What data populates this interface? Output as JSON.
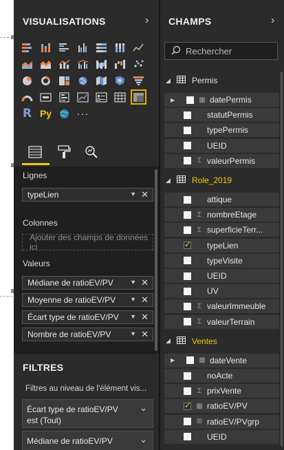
{
  "visualisations": {
    "title": "VISUALISATIONS",
    "collapse_glyph": "›",
    "icons": [
      [
        "stacked-bar-icon",
        "stacked-column-icon",
        "clustered-bar-icon",
        "clustered-column-icon",
        "100-stacked-bar-icon",
        "100-stacked-column-icon",
        "line-chart-icon"
      ],
      [
        "area-chart-icon",
        "stacked-area-icon",
        "line-column-icon",
        "line-clustered-column-icon",
        "ribbon-chart-icon",
        "waterfall-icon",
        "scatter-icon"
      ],
      [
        "pie-chart-icon",
        "donut-chart-icon",
        "treemap-icon",
        "map-icon",
        "filled-map-icon",
        "shape-map-icon",
        "funnel-icon"
      ],
      [
        "gauge-icon",
        "card-icon",
        "multi-row-card-icon",
        "kpi-icon",
        "slicer-icon",
        "table-icon",
        "matrix-icon"
      ],
      [
        "r-visual-icon",
        "python-visual-icon",
        "arcgis-icon",
        "more-visuals-icon"
      ]
    ],
    "r_label": "R",
    "py_label": "Py",
    "more_label": "···",
    "tabs": [
      "fields-tab-icon",
      "format-tab-icon",
      "analytics-tab-icon"
    ]
  },
  "wells": {
    "rows_label": "Lignes",
    "rows_fields": [
      "typeLien"
    ],
    "columns_label": "Colonnes",
    "columns_placeholder": "Ajouter des champs de données ici",
    "values_label": "Valeurs",
    "values_fields": [
      "Médiane de ratioEV/PV",
      "Moyenne de ratioEV/PV",
      "Écart type de ratioEV/PV",
      "Nombre de ratioEV/PV"
    ]
  },
  "filters": {
    "title": "FILTRES",
    "subtitle": "Filtres au niveau de l'élément vis...",
    "cards": [
      {
        "name": "Écart type de ratioEV/PV",
        "state": "est (Tout)"
      },
      {
        "name": "Médiane de ratioEV/PV",
        "state": ""
      }
    ]
  },
  "fields": {
    "title": "CHAMPS",
    "collapse_glyph": "›",
    "search_placeholder": "Rechercher",
    "tables": [
      {
        "name": "Permis",
        "highlight": false,
        "items": [
          {
            "name": "datePermis",
            "type": "date",
            "checked": false,
            "expandable": true
          },
          {
            "name": "statutPermis",
            "type": "",
            "checked": false
          },
          {
            "name": "typePermis",
            "type": "",
            "checked": false
          },
          {
            "name": "UEID",
            "type": "",
            "checked": false
          },
          {
            "name": "valeurPermis",
            "type": "sum",
            "checked": false
          }
        ]
      },
      {
        "name": "Role_2019",
        "highlight": true,
        "items": [
          {
            "name": "attique",
            "type": "",
            "checked": false
          },
          {
            "name": "nombreEtage",
            "type": "sum",
            "checked": false
          },
          {
            "name": "superficieTerr...",
            "type": "sum",
            "checked": false
          },
          {
            "name": "typeLien",
            "type": "",
            "checked": true
          },
          {
            "name": "typeVisite",
            "type": "",
            "checked": false
          },
          {
            "name": "UEID",
            "type": "",
            "checked": false
          },
          {
            "name": "UV",
            "type": "",
            "checked": false
          },
          {
            "name": "valeurImmeuble",
            "type": "sum",
            "checked": false
          },
          {
            "name": "valeurTerrain",
            "type": "sum",
            "checked": false
          }
        ]
      },
      {
        "name": "Ventes",
        "highlight": true,
        "items": [
          {
            "name": "dateVente",
            "type": "date",
            "checked": false,
            "expandable": true
          },
          {
            "name": "noActe",
            "type": "",
            "checked": false
          },
          {
            "name": "prixVente",
            "type": "sum",
            "checked": false
          },
          {
            "name": "ratioEV/PV",
            "type": "calc",
            "checked": true
          },
          {
            "name": "ratioEV/PVgrp",
            "type": "group",
            "checked": false
          },
          {
            "name": "UEID",
            "type": "",
            "checked": false
          }
        ]
      }
    ]
  },
  "colors": {
    "accent": "#f2c811",
    "pane": "#2b2b2b",
    "well": "#1f1f1f",
    "row": "#3a3a3a"
  }
}
